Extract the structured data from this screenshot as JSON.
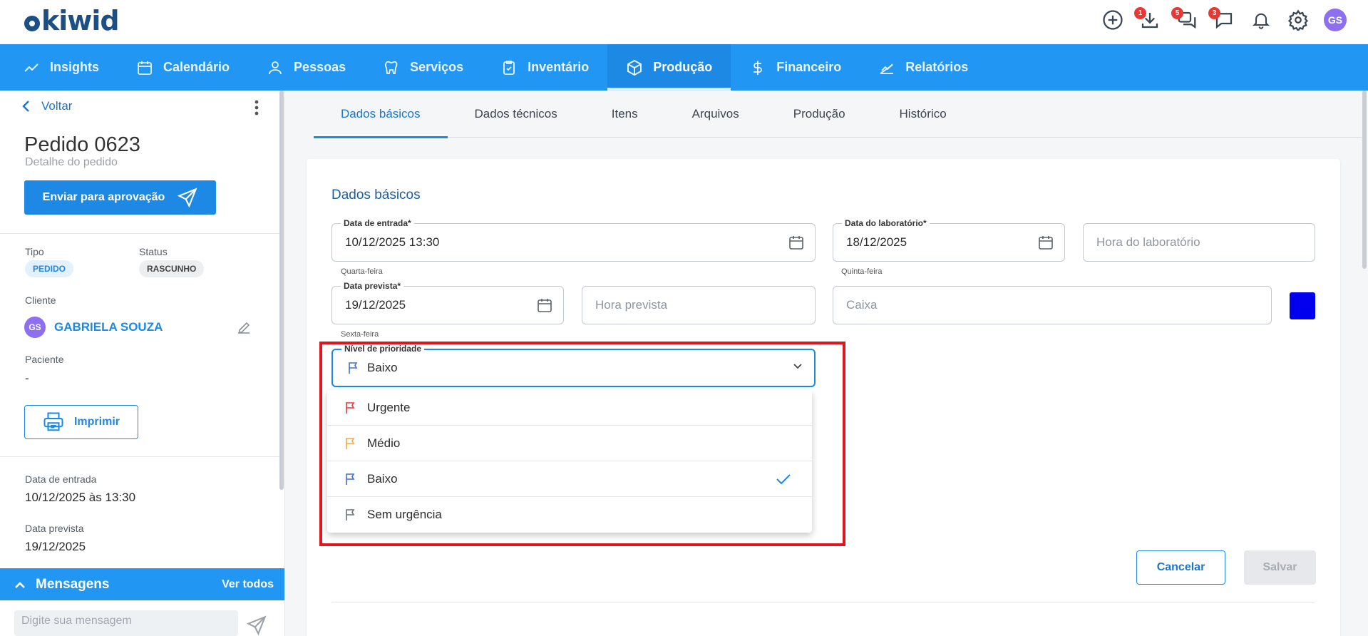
{
  "app": {
    "logo_text": "kiwid"
  },
  "top_icons": {
    "downloads_badge": "1",
    "requests_badge": "5",
    "chat_badge": "3",
    "user_initials": "GS"
  },
  "nav": {
    "items": [
      {
        "label": "Insights",
        "icon": "trend-icon"
      },
      {
        "label": "Calendário",
        "icon": "calendar-icon"
      },
      {
        "label": "Pessoas",
        "icon": "person-icon"
      },
      {
        "label": "Serviços",
        "icon": "tooth-icon"
      },
      {
        "label": "Inventário",
        "icon": "clipboard-icon"
      },
      {
        "label": "Produção",
        "icon": "box-icon",
        "active": true
      },
      {
        "label": "Financeiro",
        "icon": "dollar-icon"
      },
      {
        "label": "Relatórios",
        "icon": "chart-icon"
      }
    ]
  },
  "sidebar": {
    "back_label": "Voltar",
    "order_title": "Pedido 0623",
    "order_subtitle": "Detalhe do pedido",
    "send_button": "Enviar para aprovação",
    "tipo_label": "Tipo",
    "tipo_value": "PEDIDO",
    "status_label": "Status",
    "status_value": "RASCUNHO",
    "cliente_label": "Cliente",
    "cliente_initials": "GS",
    "cliente_name": "GABRIELA SOUZA",
    "paciente_label": "Paciente",
    "paciente_value": "-",
    "print_button": "Imprimir",
    "entrada_label": "Data de entrada",
    "entrada_value": "10/12/2025 às 13:30",
    "prevista_label": "Data prevista",
    "prevista_value": "19/12/2025",
    "messages_title": "Mensagens",
    "messages_see_all": "Ver todos",
    "message_placeholder": "Digite sua mensagem"
  },
  "tabs": [
    {
      "label": "Dados básicos",
      "active": true
    },
    {
      "label": "Dados técnicos"
    },
    {
      "label": "Itens"
    },
    {
      "label": "Arquivos"
    },
    {
      "label": "Produção"
    },
    {
      "label": "Histórico"
    }
  ],
  "form": {
    "section_title": "Dados básicos",
    "data_entrada": {
      "label": "Data de entrada*",
      "value": "10/12/2025 13:30",
      "helper": "Quarta-feira"
    },
    "data_laboratorio": {
      "label": "Data do laboratório*",
      "value": "18/12/2025",
      "helper": "Quinta-feira"
    },
    "hora_laboratorio": {
      "placeholder": "Hora do laboratório"
    },
    "data_prevista": {
      "label": "Data prevista*",
      "value": "19/12/2025",
      "helper": "Sexta-feira"
    },
    "hora_prevista": {
      "placeholder": "Hora prevista"
    },
    "caixa": {
      "placeholder": "Caixa"
    },
    "color_value": "#0000ee",
    "prioridade": {
      "label": "Nível de prioridade",
      "value": "Baixo",
      "options": [
        {
          "label": "Urgente",
          "flag_color": "#e53935"
        },
        {
          "label": "Médio",
          "flag_color": "#f5a742"
        },
        {
          "label": "Baixo",
          "flag_color": "#3f6fd1",
          "selected": true
        },
        {
          "label": "Sem urgência",
          "flag_color": "#6b7178"
        }
      ]
    },
    "cancel_button": "Cancelar",
    "save_button": "Salvar"
  },
  "colors": {
    "primary": "#2196f3",
    "highlight": "#e0161c"
  }
}
